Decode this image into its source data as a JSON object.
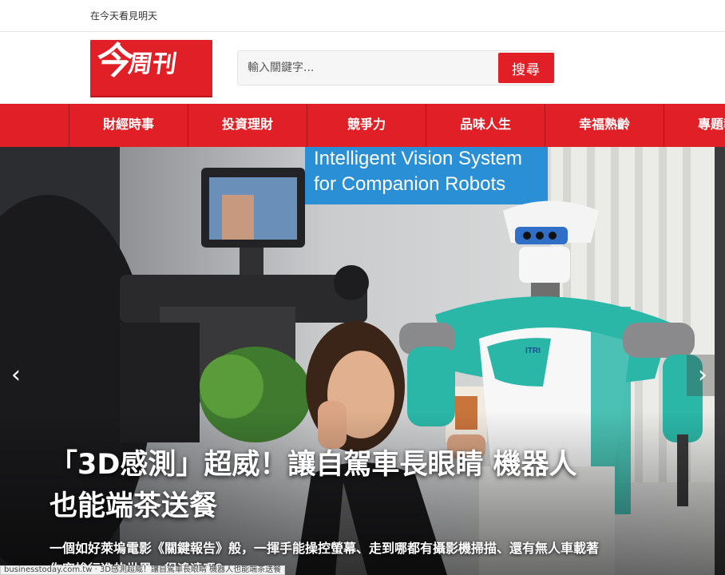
{
  "topbar": {
    "tagline": "在今天看見明天"
  },
  "logo": {
    "text_big": "今",
    "text_small": "周刊"
  },
  "search": {
    "placeholder": "輸入關鍵字...",
    "value": "",
    "button_label": "搜尋"
  },
  "nav": {
    "items": [
      {
        "label": "財經時事"
      },
      {
        "label": "投資理財"
      },
      {
        "label": "競爭力"
      },
      {
        "label": "品味人生"
      },
      {
        "label": "幸福熟齡"
      },
      {
        "label": "專題報導"
      }
    ]
  },
  "hero": {
    "banner_line1": "Intelligent Vision System",
    "banner_line2": "for Companion Robots",
    "robot_badge": "ITRI",
    "headline_line1": "「3D感測」超威！讓自駕車長眼睛 機器人",
    "headline_line2": "也能端茶送餐",
    "summary_line1": "一個如好萊塢電影《關鍵報告》般，一揮手能操控螢幕、走到哪都有攝影機掃描、還有無人車載著",
    "summary_line2": "你穿梭行進的世界，很遙遠嗎？",
    "prev_icon": "‹",
    "next_icon": "›",
    "status_url": "businesstoday.com.tw · 3D感測超威！讓自駕車長眼睛 機器人也能端茶送餐"
  },
  "colors": {
    "brand_red": "#e01f26",
    "nav_divider": "#a9141a",
    "robot_teal": "#2bb7a8",
    "banner_blue": "#2a8fd4"
  }
}
